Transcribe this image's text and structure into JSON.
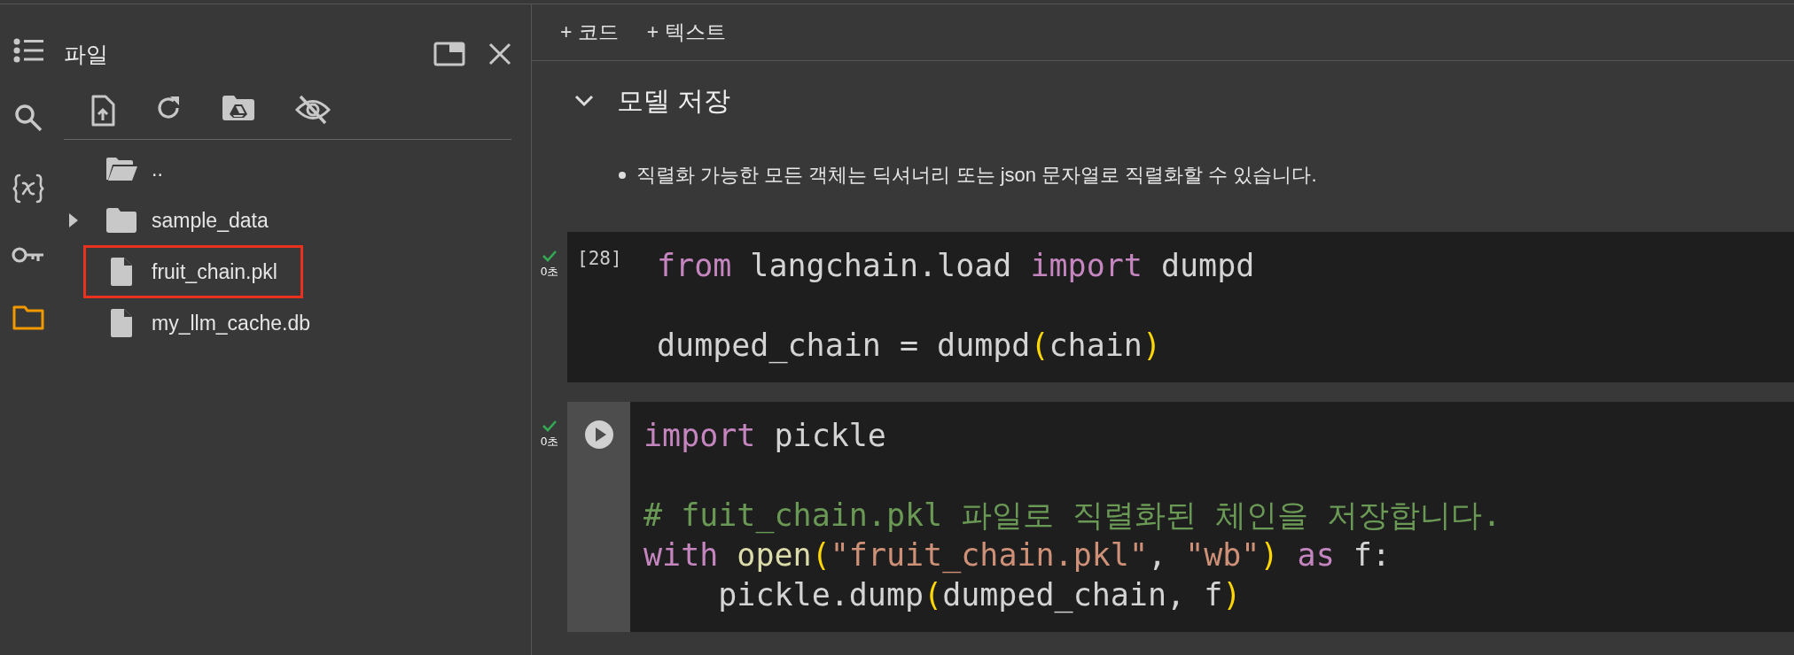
{
  "rail": [
    {
      "kind": "toc",
      "selected": false
    },
    {
      "kind": "search",
      "selected": false
    },
    {
      "kind": "variables",
      "selected": false
    },
    {
      "kind": "secrets",
      "selected": false
    },
    {
      "kind": "files",
      "selected": true
    }
  ],
  "files_panel": {
    "title": "파일",
    "items": [
      {
        "name": "..",
        "kind": "parent",
        "highlighted": false
      },
      {
        "name": "sample_data",
        "kind": "folder",
        "expanded": false,
        "highlighted": false
      },
      {
        "name": "fruit_chain.pkl",
        "kind": "file",
        "highlighted": true
      },
      {
        "name": "my_llm_cache.db",
        "kind": "file",
        "highlighted": false
      }
    ]
  },
  "toolbar": [
    {
      "label": "+ 코드"
    },
    {
      "label": "+ 텍스트"
    }
  ],
  "section": {
    "heading": "모델 저장",
    "expanded": true,
    "bullets": [
      "직렬화 가능한 모든 객체는 딕셔너리 또는 json 문자열로 직렬화할 수 있습니다."
    ]
  },
  "cells": [
    {
      "execution_count": "[28]",
      "time": "0초",
      "succeeded": true,
      "run_button": false,
      "blocks": [
        [
          {
            "tokens": [
              {
                "kind": "keyword",
                "text": "from"
              },
              {
                "kind": "plain",
                "text": " langchain.load "
              },
              {
                "kind": "keyword",
                "text": "import"
              },
              {
                "kind": "plain",
                "text": " dumpd"
              }
            ]
          }
        ],
        [
          {
            "tokens": [
              {
                "kind": "plain",
                "text": "dumped_chain = dumpd"
              },
              {
                "kind": "bracket",
                "text": "("
              },
              {
                "kind": "plain",
                "text": "chain"
              },
              {
                "kind": "bracket",
                "text": ")"
              }
            ]
          }
        ]
      ]
    },
    {
      "time": "0초",
      "succeeded": true,
      "run_button": true,
      "blocks": [
        [
          {
            "tokens": [
              {
                "kind": "keyword",
                "text": "import"
              },
              {
                "kind": "plain",
                "text": " pickle"
              }
            ]
          }
        ],
        [
          {
            "tokens": [
              {
                "kind": "comment",
                "text": "# fuit_chain.pkl 파일로 직렬화된 체인을 저장합니다."
              }
            ]
          },
          {
            "tokens": [
              {
                "kind": "keyword",
                "text": "with"
              },
              {
                "kind": "function",
                "text": " open"
              },
              {
                "kind": "bracket",
                "text": "("
              },
              {
                "kind": "string",
                "text": "\"fruit_chain.pkl\""
              },
              {
                "kind": "plain",
                "text": ", "
              },
              {
                "kind": "string",
                "text": "\"wb\""
              },
              {
                "kind": "bracket",
                "text": ")"
              },
              {
                "kind": "keyword",
                "text": " as"
              },
              {
                "kind": "plain",
                "text": " f:"
              }
            ]
          },
          {
            "tokens": [
              {
                "kind": "plain",
                "text": "    pickle.dump"
              },
              {
                "kind": "bracket",
                "text": "("
              },
              {
                "kind": "plain",
                "text": "dumped_chain, f"
              },
              {
                "kind": "bracket",
                "text": ")"
              }
            ]
          }
        ]
      ]
    }
  ]
}
